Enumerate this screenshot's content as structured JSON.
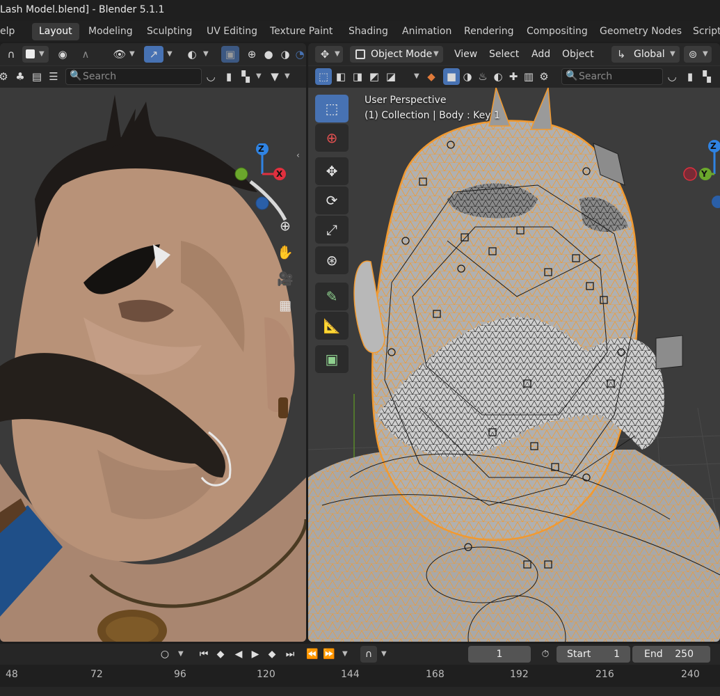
{
  "window": {
    "title": "Lash Model.blend] - Blender 5.1.1"
  },
  "workspace_tabs": [
    {
      "label": "elp",
      "active": false
    },
    {
      "label": "Layout",
      "active": true
    },
    {
      "label": "Modeling",
      "active": false
    },
    {
      "label": "Sculpting",
      "active": false
    },
    {
      "label": "UV Editing",
      "active": false
    },
    {
      "label": "Texture Paint",
      "active": false
    },
    {
      "label": "Shading",
      "active": false
    },
    {
      "label": "Animation",
      "active": false
    },
    {
      "label": "Rendering",
      "active": false
    },
    {
      "label": "Compositing",
      "active": false
    },
    {
      "label": "Geometry Nodes",
      "active": false
    },
    {
      "label": "Script",
      "active": false
    }
  ],
  "left_viewport": {
    "search_placeholder": "Search"
  },
  "right_viewport": {
    "mode": "Object Mode",
    "menus": [
      "View",
      "Select",
      "Add",
      "Object"
    ],
    "transform_orientation": "Global",
    "search_placeholder": "Search",
    "overlay_line1": "User Perspective",
    "overlay_line2": "(1) Collection | Body : Key 1"
  },
  "gizmo": {
    "z_label": "Z",
    "x_label": "X",
    "y_label": "Y",
    "z_color": "#2f83e3",
    "x_color": "#e0303e",
    "y_color": "#6ba72c"
  },
  "timeline": {
    "current_frame": "1",
    "start_label": "Start",
    "start_value": "1",
    "end_label": "End",
    "end_value": "250",
    "ruler_ticks": [
      "48",
      "72",
      "96",
      "120",
      "144",
      "168",
      "192",
      "216",
      "240"
    ]
  },
  "colors": {
    "accent": "#4772b3",
    "wire_selected": "#f29a30",
    "skin": "#b89278"
  }
}
